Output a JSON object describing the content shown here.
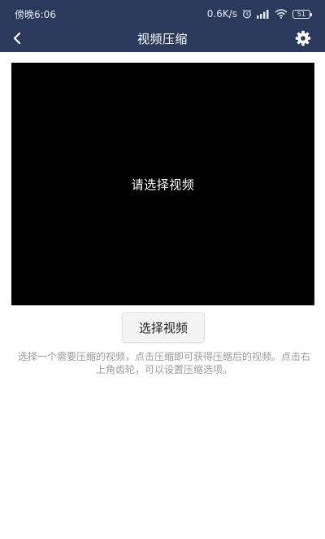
{
  "status_bar": {
    "time": "傍晚6:06",
    "network_speed": "0.6K/s",
    "battery_level": "51"
  },
  "nav": {
    "title": "视频压缩",
    "back_icon": "chevron-left-icon",
    "settings_icon": "gear-icon"
  },
  "video_preview": {
    "placeholder": "请选择视频"
  },
  "actions": {
    "select_video_label": "选择视频"
  },
  "hint": {
    "text": "选择一个需要压缩的视频，点击压缩即可获得压缩后的视频。点击右上角齿轮，可以设置压缩选项。"
  },
  "colors": {
    "header_bg": "#2b3a5c",
    "video_bg": "#000000",
    "hint_text": "#9b9b9b"
  }
}
